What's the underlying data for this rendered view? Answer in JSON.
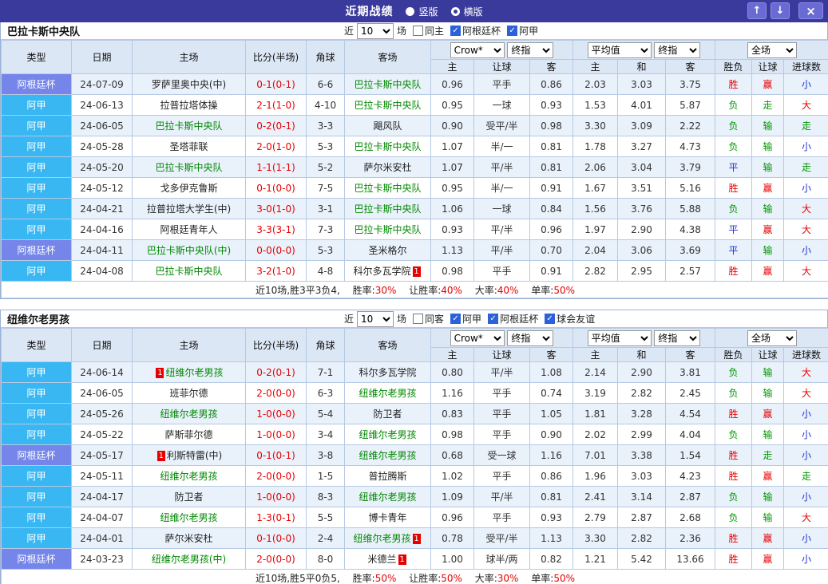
{
  "titlebar": {
    "title": "近期战绩",
    "radios": [
      {
        "label": "竖版",
        "selected": false
      },
      {
        "label": "横版",
        "selected": true
      }
    ],
    "buttons": {
      "up": "↑",
      "down": "↓",
      "close": "×"
    }
  },
  "colors": {
    "titlebar_bg": "#3a3a9c",
    "cup_badge": "#7585ea",
    "league_badge": "#38b7f2",
    "win_red": "#e80000",
    "lose_green": "#009900",
    "draw_blue": "#2233cc",
    "focus_team_green": "#008800",
    "row_alt_blue": "#e9f1fb"
  },
  "tables": [
    {
      "team": "巴拉卡斯中央队",
      "near": "近",
      "count": "10",
      "unit": "场",
      "filters": [
        {
          "label": "同主",
          "checked": false
        },
        {
          "label": "阿根廷杯",
          "checked": true
        },
        {
          "label": "阿甲",
          "checked": true
        }
      ],
      "selects": {
        "book": "Crow*",
        "book_period": "终指",
        "avg": "平均值",
        "avg_period": "终指",
        "scope": "全场"
      },
      "headers": {
        "type": "类型",
        "date": "日期",
        "home": "主场",
        "score": "比分(半场)",
        "corner": "角球",
        "away": "客场",
        "sub": [
          "主",
          "让球",
          "客",
          "主",
          "和",
          "客",
          "胜负",
          "让球",
          "进球数"
        ]
      },
      "rows": [
        {
          "type": "阿根廷杯",
          "type_style": "cup",
          "date": "24-07-09",
          "home": {
            "name": "罗萨里奥中央(中)",
            "focus": false
          },
          "score": "0-1(0-1)",
          "corner": "6-6",
          "away": {
            "name": "巴拉卡斯中央队",
            "focus": true
          },
          "odds": [
            "0.96",
            "平手",
            "0.86",
            "2.03",
            "3.03",
            "3.75"
          ],
          "results": [
            [
              "胜",
              "r"
            ],
            [
              "赢",
              "r"
            ],
            [
              "小",
              "b"
            ]
          ]
        },
        {
          "type": "阿甲",
          "type_style": "lg",
          "date": "24-06-13",
          "home": {
            "name": "拉普拉塔体操",
            "focus": false
          },
          "score": "2-1(1-0)",
          "corner": "4-10",
          "away": {
            "name": "巴拉卡斯中央队",
            "focus": true
          },
          "odds": [
            "0.95",
            "一球",
            "0.93",
            "1.53",
            "4.01",
            "5.87"
          ],
          "results": [
            [
              "负",
              "g"
            ],
            [
              "走",
              "g"
            ],
            [
              "大",
              "r"
            ]
          ]
        },
        {
          "type": "阿甲",
          "type_style": "lg",
          "date": "24-06-05",
          "home": {
            "name": "巴拉卡斯中央队",
            "focus": true
          },
          "score": "0-2(0-1)",
          "corner": "3-3",
          "away": {
            "name": "飓风队",
            "focus": false
          },
          "odds": [
            "0.90",
            "受平/半",
            "0.98",
            "3.30",
            "3.09",
            "2.22"
          ],
          "results": [
            [
              "负",
              "g"
            ],
            [
              "输",
              "g"
            ],
            [
              "走",
              "g"
            ]
          ]
        },
        {
          "type": "阿甲",
          "type_style": "lg",
          "date": "24-05-28",
          "home": {
            "name": "圣塔菲联",
            "focus": false
          },
          "score": "2-0(1-0)",
          "corner": "5-3",
          "away": {
            "name": "巴拉卡斯中央队",
            "focus": true
          },
          "odds": [
            "1.07",
            "半/一",
            "0.81",
            "1.78",
            "3.27",
            "4.73"
          ],
          "results": [
            [
              "负",
              "g"
            ],
            [
              "输",
              "g"
            ],
            [
              "小",
              "b"
            ]
          ]
        },
        {
          "type": "阿甲",
          "type_style": "lg",
          "date": "24-05-20",
          "home": {
            "name": "巴拉卡斯中央队",
            "focus": true
          },
          "score": "1-1(1-1)",
          "corner": "5-2",
          "away": {
            "name": "萨尔米安杜",
            "focus": false
          },
          "odds": [
            "1.07",
            "平/半",
            "0.81",
            "2.06",
            "3.04",
            "3.79"
          ],
          "results": [
            [
              "平",
              "b"
            ],
            [
              "输",
              "g"
            ],
            [
              "走",
              "g"
            ]
          ]
        },
        {
          "type": "阿甲",
          "type_style": "lg",
          "date": "24-05-12",
          "home": {
            "name": "戈多伊克鲁斯",
            "focus": false
          },
          "score": "0-1(0-0)",
          "corner": "7-5",
          "away": {
            "name": "巴拉卡斯中央队",
            "focus": true
          },
          "odds": [
            "0.95",
            "半/一",
            "0.91",
            "1.67",
            "3.51",
            "5.16"
          ],
          "results": [
            [
              "胜",
              "r"
            ],
            [
              "赢",
              "r"
            ],
            [
              "小",
              "b"
            ]
          ]
        },
        {
          "type": "阿甲",
          "type_style": "lg",
          "date": "24-04-21",
          "home": {
            "name": "拉普拉塔大学生(中)",
            "focus": false
          },
          "score": "3-0(1-0)",
          "corner": "3-1",
          "away": {
            "name": "巴拉卡斯中央队",
            "focus": true
          },
          "odds": [
            "1.06",
            "一球",
            "0.84",
            "1.56",
            "3.76",
            "5.88"
          ],
          "results": [
            [
              "负",
              "g"
            ],
            [
              "输",
              "g"
            ],
            [
              "大",
              "r"
            ]
          ]
        },
        {
          "type": "阿甲",
          "type_style": "lg",
          "date": "24-04-16",
          "home": {
            "name": "阿根廷青年人",
            "focus": false
          },
          "score": "3-3(3-1)",
          "corner": "7-3",
          "away": {
            "name": "巴拉卡斯中央队",
            "focus": true
          },
          "odds": [
            "0.93",
            "平/半",
            "0.96",
            "1.97",
            "2.90",
            "4.38"
          ],
          "results": [
            [
              "平",
              "b"
            ],
            [
              "赢",
              "r"
            ],
            [
              "大",
              "r"
            ]
          ]
        },
        {
          "type": "阿根廷杯",
          "type_style": "cup",
          "date": "24-04-11",
          "home": {
            "name": "巴拉卡斯中央队(中)",
            "focus": true
          },
          "score": "0-0(0-0)",
          "corner": "5-3",
          "away": {
            "name": "圣米格尔",
            "focus": false
          },
          "odds": [
            "1.13",
            "平/半",
            "0.70",
            "2.04",
            "3.06",
            "3.69"
          ],
          "results": [
            [
              "平",
              "b"
            ],
            [
              "输",
              "g"
            ],
            [
              "小",
              "b"
            ]
          ]
        },
        {
          "type": "阿甲",
          "type_style": "lg",
          "date": "24-04-08",
          "home": {
            "name": "巴拉卡斯中央队",
            "focus": true
          },
          "score": "3-2(1-0)",
          "corner": "4-8",
          "away": {
            "name": "科尔多瓦学院",
            "focus": false,
            "card_after": "1"
          },
          "odds": [
            "0.98",
            "平手",
            "0.91",
            "2.82",
            "2.95",
            "2.57"
          ],
          "results": [
            [
              "胜",
              "r"
            ],
            [
              "赢",
              "r"
            ],
            [
              "大",
              "r"
            ]
          ]
        }
      ],
      "footer": {
        "summary": "近10场,胜3平3负4,",
        "stats": [
          {
            "label": "胜率:",
            "value": "30%"
          },
          {
            "label": "让胜率:",
            "value": "40%"
          },
          {
            "label": "大率:",
            "value": "40%"
          },
          {
            "label": "单率:",
            "value": "50%"
          }
        ]
      }
    },
    {
      "team": "纽维尔老男孩",
      "near": "近",
      "count": "10",
      "unit": "场",
      "filters": [
        {
          "label": "同客",
          "checked": false
        },
        {
          "label": "阿甲",
          "checked": true
        },
        {
          "label": "阿根廷杯",
          "checked": true
        },
        {
          "label": "球会友谊",
          "checked": true
        }
      ],
      "selects": {
        "book": "Crow*",
        "book_period": "终指",
        "avg": "平均值",
        "avg_period": "终指",
        "scope": "全场"
      },
      "headers": {
        "type": "类型",
        "date": "日期",
        "home": "主场",
        "score": "比分(半场)",
        "corner": "角球",
        "away": "客场",
        "sub": [
          "主",
          "让球",
          "客",
          "主",
          "和",
          "客",
          "胜负",
          "让球",
          "进球数"
        ]
      },
      "rows": [
        {
          "type": "阿甲",
          "type_style": "lg",
          "date": "24-06-14",
          "home": {
            "name": "纽维尔老男孩",
            "focus": true,
            "card_before": "1"
          },
          "score": "0-2(0-1)",
          "corner": "7-1",
          "away": {
            "name": "科尔多瓦学院",
            "focus": false
          },
          "odds": [
            "0.80",
            "平/半",
            "1.08",
            "2.14",
            "2.90",
            "3.81"
          ],
          "results": [
            [
              "负",
              "g"
            ],
            [
              "输",
              "g"
            ],
            [
              "大",
              "r"
            ]
          ]
        },
        {
          "type": "阿甲",
          "type_style": "lg",
          "date": "24-06-05",
          "home": {
            "name": "班菲尔德",
            "focus": false
          },
          "score": "2-0(0-0)",
          "corner": "6-3",
          "away": {
            "name": "纽维尔老男孩",
            "focus": true
          },
          "odds": [
            "1.16",
            "平手",
            "0.74",
            "3.19",
            "2.82",
            "2.45"
          ],
          "results": [
            [
              "负",
              "g"
            ],
            [
              "输",
              "g"
            ],
            [
              "大",
              "r"
            ]
          ]
        },
        {
          "type": "阿甲",
          "type_style": "lg",
          "date": "24-05-26",
          "home": {
            "name": "纽维尔老男孩",
            "focus": true
          },
          "score": "1-0(0-0)",
          "corner": "5-4",
          "away": {
            "name": "防卫者",
            "focus": false
          },
          "odds": [
            "0.83",
            "平手",
            "1.05",
            "1.81",
            "3.28",
            "4.54"
          ],
          "results": [
            [
              "胜",
              "r"
            ],
            [
              "赢",
              "r"
            ],
            [
              "小",
              "b"
            ]
          ]
        },
        {
          "type": "阿甲",
          "type_style": "lg",
          "date": "24-05-22",
          "home": {
            "name": "萨斯菲尔德",
            "focus": false
          },
          "score": "1-0(0-0)",
          "corner": "3-4",
          "away": {
            "name": "纽维尔老男孩",
            "focus": true
          },
          "odds": [
            "0.98",
            "平手",
            "0.90",
            "2.02",
            "2.99",
            "4.04"
          ],
          "results": [
            [
              "负",
              "g"
            ],
            [
              "输",
              "g"
            ],
            [
              "小",
              "b"
            ]
          ]
        },
        {
          "type": "阿根廷杯",
          "type_style": "cup",
          "date": "24-05-17",
          "home": {
            "name": "利斯特雷(中)",
            "focus": false,
            "card_before": "1"
          },
          "score": "0-1(0-1)",
          "corner": "3-8",
          "away": {
            "name": "纽维尔老男孩",
            "focus": true
          },
          "odds": [
            "0.68",
            "受一球",
            "1.16",
            "7.01",
            "3.38",
            "1.54"
          ],
          "results": [
            [
              "胜",
              "r"
            ],
            [
              "走",
              "g"
            ],
            [
              "小",
              "b"
            ]
          ]
        },
        {
          "type": "阿甲",
          "type_style": "lg",
          "date": "24-05-11",
          "home": {
            "name": "纽维尔老男孩",
            "focus": true
          },
          "score": "2-0(0-0)",
          "corner": "1-5",
          "away": {
            "name": "普拉腾斯",
            "focus": false
          },
          "odds": [
            "1.02",
            "平手",
            "0.86",
            "1.96",
            "3.03",
            "4.23"
          ],
          "results": [
            [
              "胜",
              "r"
            ],
            [
              "赢",
              "r"
            ],
            [
              "走",
              "g"
            ]
          ]
        },
        {
          "type": "阿甲",
          "type_style": "lg",
          "date": "24-04-17",
          "home": {
            "name": "防卫者",
            "focus": false
          },
          "score": "1-0(0-0)",
          "corner": "8-3",
          "away": {
            "name": "纽维尔老男孩",
            "focus": true
          },
          "odds": [
            "1.09",
            "平/半",
            "0.81",
            "2.41",
            "3.14",
            "2.87"
          ],
          "results": [
            [
              "负",
              "g"
            ],
            [
              "输",
              "g"
            ],
            [
              "小",
              "b"
            ]
          ]
        },
        {
          "type": "阿甲",
          "type_style": "lg",
          "date": "24-04-07",
          "home": {
            "name": "纽维尔老男孩",
            "focus": true
          },
          "score": "1-3(0-1)",
          "corner": "5-5",
          "away": {
            "name": "博卡青年",
            "focus": false
          },
          "odds": [
            "0.96",
            "平手",
            "0.93",
            "2.79",
            "2.87",
            "2.68"
          ],
          "results": [
            [
              "负",
              "g"
            ],
            [
              "输",
              "g"
            ],
            [
              "大",
              "r"
            ]
          ]
        },
        {
          "type": "阿甲",
          "type_style": "lg",
          "date": "24-04-01",
          "home": {
            "name": "萨尔米安杜",
            "focus": false
          },
          "score": "0-1(0-0)",
          "corner": "2-4",
          "away": {
            "name": "纽维尔老男孩",
            "focus": true,
            "card_after": "1"
          },
          "odds": [
            "0.78",
            "受平/半",
            "1.13",
            "3.30",
            "2.82",
            "2.36"
          ],
          "results": [
            [
              "胜",
              "r"
            ],
            [
              "赢",
              "r"
            ],
            [
              "小",
              "b"
            ]
          ]
        },
        {
          "type": "阿根廷杯",
          "type_style": "cup",
          "date": "24-03-23",
          "home": {
            "name": "纽维尔老男孩(中)",
            "focus": true
          },
          "score": "2-0(0-0)",
          "corner": "8-0",
          "away": {
            "name": "米德兰",
            "focus": false,
            "card_after": "1"
          },
          "odds": [
            "1.00",
            "球半/两",
            "0.82",
            "1.21",
            "5.42",
            "13.66"
          ],
          "results": [
            [
              "胜",
              "r"
            ],
            [
              "赢",
              "r"
            ],
            [
              "小",
              "b"
            ]
          ]
        }
      ],
      "footer": {
        "summary": "近10场,胜5平0负5,",
        "stats": [
          {
            "label": "胜率:",
            "value": "50%"
          },
          {
            "label": "让胜率:",
            "value": "50%"
          },
          {
            "label": "大率:",
            "value": "30%"
          },
          {
            "label": "单率:",
            "value": "50%"
          }
        ]
      }
    }
  ]
}
